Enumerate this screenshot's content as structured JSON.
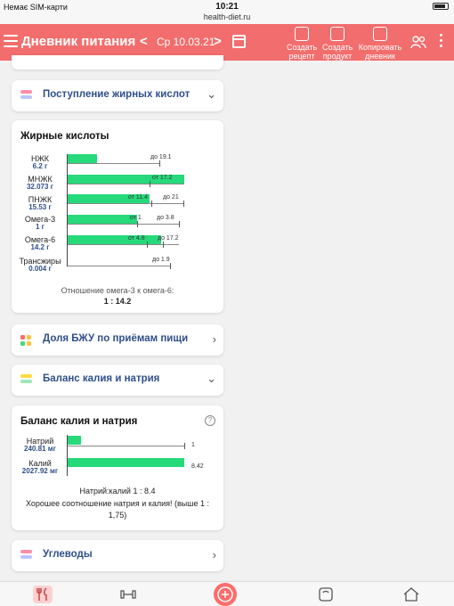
{
  "status": {
    "carrier": "Немає SIM-карти",
    "time": "10:21",
    "url": "health-diet.ru"
  },
  "header": {
    "title": "Дневник питания",
    "prev": "<",
    "next": ">",
    "date": "Ср 10.03.21",
    "actions": {
      "create_recipe": [
        "Создать",
        "рецепт"
      ],
      "create_product": [
        "Создать",
        "продукт"
      ],
      "copy_diary": [
        "Копировать",
        "дневник"
      ]
    }
  },
  "sections": {
    "fatty_acids_header": "Поступление жирных кислот",
    "bju_share": "Доля БЖУ по приёмам пищи",
    "kna_header": "Баланс калия и натрия",
    "carbs": "Углеводы"
  },
  "fatty_chart": {
    "title": "Жирные кислоты",
    "rows": [
      {
        "name": "НЖК",
        "value": "6.2 г"
      },
      {
        "name": "МНЖК",
        "value": "32.073 г"
      },
      {
        "name": "ПНЖК",
        "value": "15.53 г"
      },
      {
        "name": "Омега-3",
        "value": "1 г"
      },
      {
        "name": "Омега-6",
        "value": "14.2 г"
      },
      {
        "name": "Трансжиры",
        "value": "0.004 г"
      }
    ],
    "ref": {
      "nzhk": "до 19.1",
      "mnzhk": "от 17.2",
      "pnzhk_from": "от 11.4",
      "pnzhk_to": "до 21",
      "om3_from": "от 1",
      "om3_to": "до 3.8",
      "om6_from": "от 4.8",
      "om6_to": "до 17.2",
      "trans": "до 1.9"
    },
    "ratio_label": "Отношение омега-3 к омега-6:",
    "ratio_value": "1 : 14.2"
  },
  "kna_chart": {
    "title": "Баланс калия и натрия",
    "help": "?",
    "rows": [
      {
        "name": "Натрий",
        "value": "240.81 мг",
        "ref": "1"
      },
      {
        "name": "Калий",
        "value": "2027.92 мг",
        "ref": "8.42"
      }
    ],
    "ratio": "Натрий:калий 1 : 8.4",
    "comment": "Хорошее соотношение натрия и калия! (выше 1 : 1,75)"
  },
  "colors": {
    "accent": "#f26d6d",
    "bar": "#26d97a",
    "link": "#2f4f8a"
  }
}
